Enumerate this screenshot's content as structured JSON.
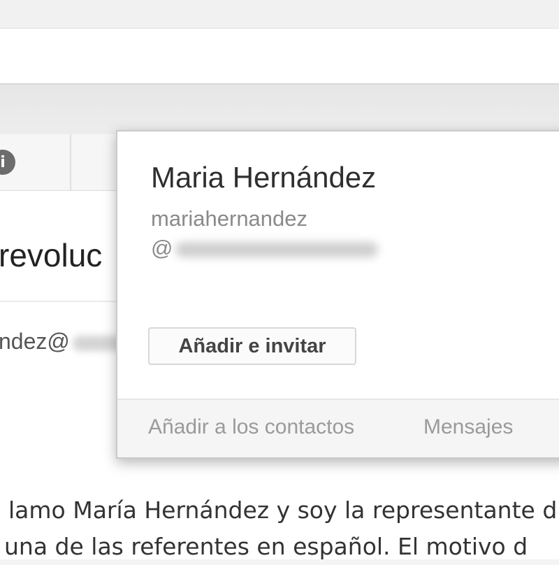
{
  "background": {
    "subject_fragment": "revoluc",
    "sender_fragment": "ndez@",
    "body_lines": [
      "lamo María Hernández y soy la representante d",
      "una de las referentes en español. El motivo d"
    ]
  },
  "icons": {
    "info": "i"
  },
  "contact_card": {
    "name": "Maria Hernández",
    "email_user": "mariahernandez",
    "email_at": "@",
    "add_invite_label": "Añadir e invitar",
    "footer": {
      "add_contacts_label": "Añadir a los contactos",
      "messages_label": "Mensajes"
    }
  },
  "colors": {
    "card_background": "#ffffff",
    "footer_background": "#f5f5f5",
    "link_gray": "#9a9a9a"
  }
}
